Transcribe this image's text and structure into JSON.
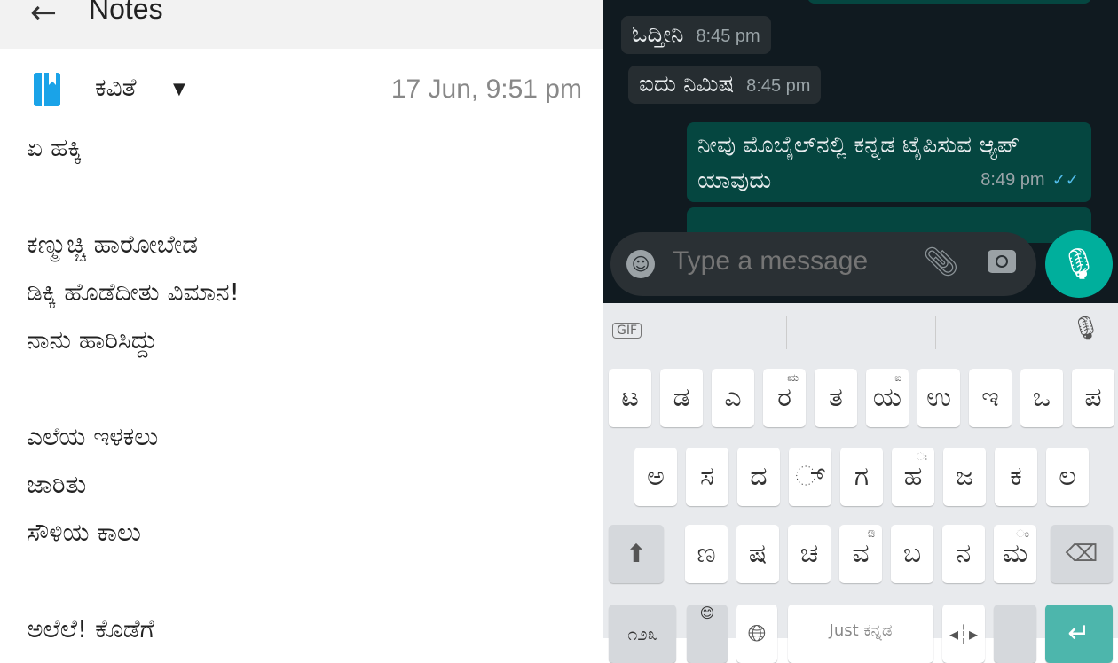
{
  "notes": {
    "title": "Notes",
    "folder": "ಕವಿತೆ",
    "date": "17 Jun, 9:51 pm",
    "lines": [
      "ಏ ಹಕ್ಕಿ",
      "",
      "ಕಣ್ಮುಚ್ಚಿ ಹಾರೋಬೇಡ",
      "ಡಿಕ್ಕಿ ಹೊಡೆದೀತು ವಿಮಾನ!",
      "ನಾನು ಹಾರಿಸಿದ್ದು",
      "",
      "ಎಲೆಯ ಇಳಕಲು",
      "ಜಾರಿತು",
      "ಸೌಳಿಯ ಕಾಲು",
      "",
      "ಅಲೆಲೆ! ಕೊಡೆಗೆ"
    ]
  },
  "chat": {
    "messages": [
      {
        "text": "ಓದ್ತೀನಿ",
        "time": "8:45 pm",
        "dir": "in"
      },
      {
        "text": "ಐದು ನಿಮಿಷ",
        "time": "8:45 pm",
        "dir": "in"
      },
      {
        "text": "ನೀವು ಮೊಬೈಲ್‌ನಲ್ಲಿ ಕನ್ನಡ ಟೈಪಿಸುವ ಆ್ಯಪ್ ಯಾವುದು",
        "time": "8:49 pm",
        "dir": "out",
        "status": "read"
      }
    ],
    "placeholder": "Type a message"
  },
  "keyboard": {
    "gif": "GIF",
    "space": "Just ಕನ್ನಡ",
    "symbols": "೧೨೩",
    "row1": [
      [
        "ಟ",
        ""
      ],
      [
        "ಡ",
        ""
      ],
      [
        "ಎ",
        ""
      ],
      [
        "ರ",
        "ಋ"
      ],
      [
        "ತ",
        ""
      ],
      [
        "ಯ",
        "ಐ"
      ],
      [
        "ಉ",
        ""
      ],
      [
        "ಇ",
        ""
      ],
      [
        "ಒ",
        ""
      ],
      [
        "ಪ",
        ""
      ]
    ],
    "row2": [
      [
        "ಅ",
        ""
      ],
      [
        "ಸ",
        ""
      ],
      [
        "ದ",
        ""
      ],
      [
        "್",
        ""
      ],
      [
        "ಗ",
        ""
      ],
      [
        "ಹ",
        "ಃ"
      ],
      [
        "ಜ",
        ""
      ],
      [
        "ಕ",
        ""
      ],
      [
        "ಲ",
        ""
      ]
    ],
    "row3": [
      [
        "ಣ",
        ""
      ],
      [
        "ಷ",
        ""
      ],
      [
        "ಚ",
        ""
      ],
      [
        "ವ",
        "ಔ"
      ],
      [
        "ಬ",
        ""
      ],
      [
        "ನ",
        ""
      ],
      [
        "ಮ",
        "ಂ"
      ]
    ]
  },
  "colors": {
    "accent": "#00af9c",
    "outgoing": "#054640",
    "incoming": "#262d31"
  }
}
